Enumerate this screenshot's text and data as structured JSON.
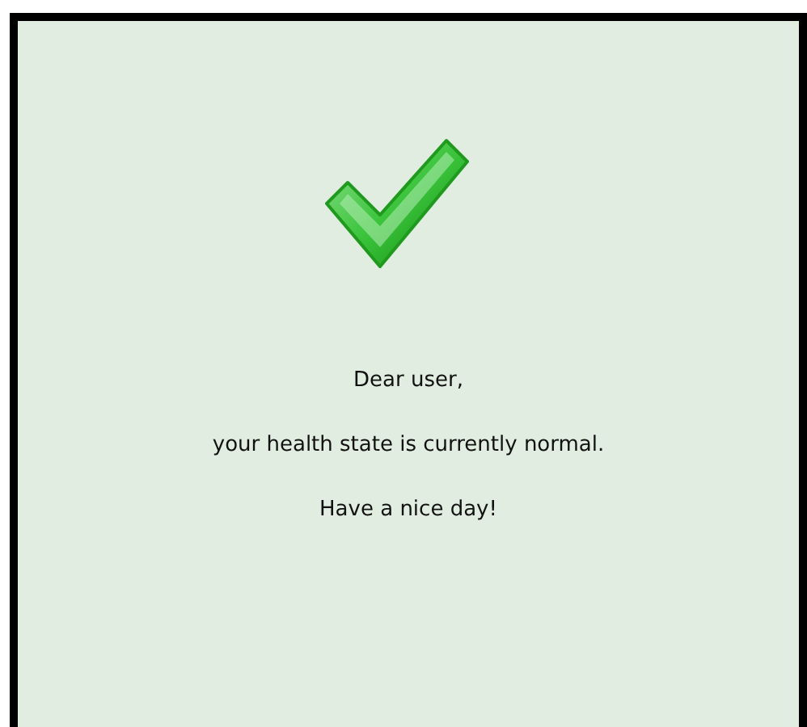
{
  "message_lines": [
    "Dear user,",
    "your health state is currently normal.",
    "Have a nice day!"
  ]
}
